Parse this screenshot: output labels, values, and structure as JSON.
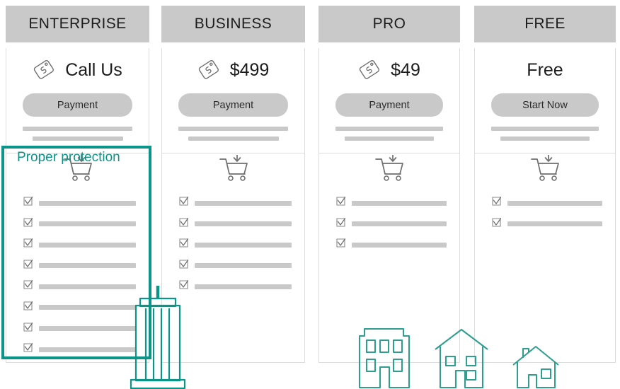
{
  "colors": {
    "accent": "#0d9488",
    "header_gray": "#c9c9c9",
    "placeholder_gray": "#c9c9c9",
    "card_border": "#dcdcdc",
    "text": "#1c1c1c",
    "page_background": "#ffffff"
  },
  "highlight": {
    "label": "Proper protection",
    "target_plan": "ENTERPRISE",
    "border_color": "#0d9488"
  },
  "plans": [
    {
      "id": "enterprise",
      "name": "ENTERPRISE",
      "price": "Call Us",
      "has_price_tag_icon": true,
      "cta_label": "Payment",
      "cart_icon": "shopping-cart-download-icon",
      "placeholder_bar_count": 2,
      "feature_count": 8,
      "highlighted": true
    },
    {
      "id": "business",
      "name": "BUSINESS",
      "price": "$499",
      "has_price_tag_icon": true,
      "cta_label": "Payment",
      "cart_icon": "shopping-cart-download-icon",
      "placeholder_bar_count": 2,
      "feature_count": 5,
      "highlighted": false
    },
    {
      "id": "pro",
      "name": "PRO",
      "price": "$49",
      "has_price_tag_icon": true,
      "cta_label": "Payment",
      "cart_icon": "shopping-cart-download-icon",
      "placeholder_bar_count": 2,
      "feature_count": 3,
      "highlighted": false
    },
    {
      "id": "free",
      "name": "FREE",
      "price": "Free",
      "has_price_tag_icon": false,
      "cta_label": "Start Now",
      "cart_icon": "shopping-cart-download-icon",
      "placeholder_bar_count": 2,
      "feature_count": 2,
      "highlighted": false
    }
  ],
  "illustrations": [
    {
      "id": "skyscraper",
      "icon": "skyscraper-icon",
      "color": "#0d9488"
    },
    {
      "id": "office-building",
      "icon": "office-building-icon",
      "color": "#2f9e8f"
    },
    {
      "id": "house-large",
      "icon": "house-icon",
      "color": "#2f9e8f"
    },
    {
      "id": "house-small",
      "icon": "house-small-icon",
      "color": "#2f9e8f"
    }
  ]
}
